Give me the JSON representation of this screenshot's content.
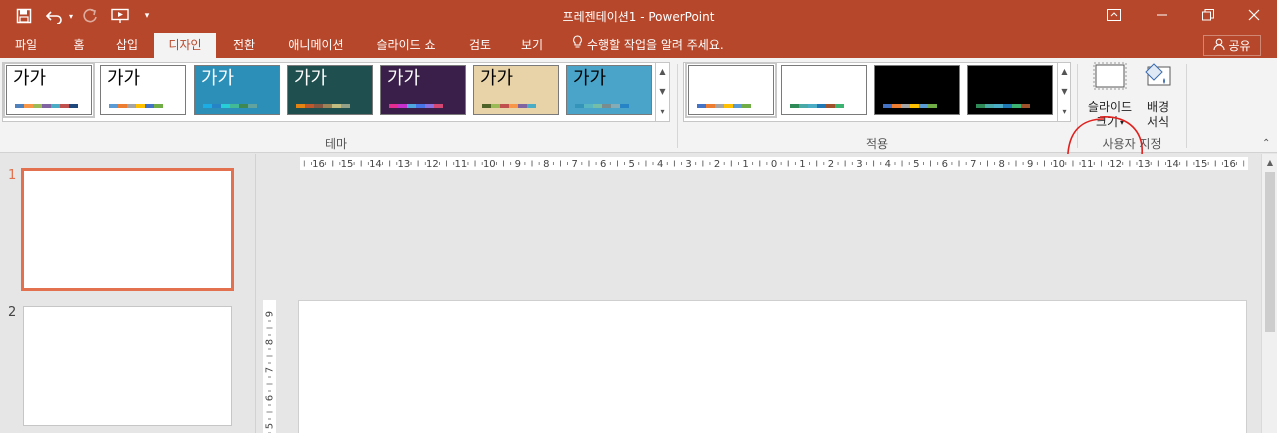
{
  "window": {
    "title": "프레젠테이션1 - PowerPoint",
    "accent": "#b7472a",
    "quick_access_icons": [
      "save-icon",
      "undo-icon",
      "undo-dropdown-icon",
      "redo-icon",
      "start-from-beginning-icon",
      "customize-quick-access-icon"
    ],
    "window_controls": [
      "ribbon-display-options-icon",
      "minimize-icon",
      "restore-icon",
      "close-icon"
    ]
  },
  "tabs": [
    {
      "label": "파일",
      "active": false
    },
    {
      "label": "홈",
      "active": false
    },
    {
      "label": "삽입",
      "active": false
    },
    {
      "label": "디자인",
      "active": true
    },
    {
      "label": "전환",
      "active": false
    },
    {
      "label": "애니메이션",
      "active": false
    },
    {
      "label": "슬라이드 쇼",
      "active": false
    },
    {
      "label": "검토",
      "active": false
    },
    {
      "label": "보기",
      "active": false
    }
  ],
  "tell_me": "수행할 작업을 알려 주세요.",
  "share": "공유",
  "ribbon": {
    "themes": {
      "label": "테마",
      "items": [
        {
          "text": "가가",
          "bg": "#ffffff",
          "fg": "#000000",
          "swatches": [
            "#4f81bd",
            "#f79646",
            "#9bbb59",
            "#8064a2",
            "#4bacc6",
            "#c0504d",
            "#1f497d"
          ]
        },
        {
          "text": "가가",
          "bg": "#ffffff",
          "fg": "#000000",
          "swatches": [
            "#5b9bd5",
            "#ed7d31",
            "#a5a5a5",
            "#ffc000",
            "#4472c4",
            "#70ad47"
          ]
        },
        {
          "text": "가가",
          "bg": "#2c8fb8",
          "fg": "#ffffff",
          "swatches": [
            "#1cade4",
            "#2683c6",
            "#27ced7",
            "#42ba97",
            "#3e8853",
            "#62a39f"
          ]
        },
        {
          "text": "가가",
          "bg": "#1f4f4f",
          "fg": "#ffffff",
          "swatches": [
            "#e48312",
            "#bd582c",
            "#865640",
            "#9b8357",
            "#c2bc80",
            "#94a088"
          ]
        },
        {
          "text": "가가",
          "bg": "#3a1f4a",
          "fg": "#ffffff",
          "swatches": [
            "#e32d91",
            "#c830cc",
            "#4ea6dc",
            "#4775e7",
            "#8971e1",
            "#d54773"
          ]
        },
        {
          "text": "가가",
          "bg": "#e8d3a8",
          "fg": "#000000",
          "swatches": [
            "#4f6228",
            "#9bbb59",
            "#c0504d",
            "#f79646",
            "#8064a2",
            "#4bacc6"
          ]
        },
        {
          "text": "가가",
          "bg": "#4aa3c8",
          "fg": "#000000",
          "swatches": [
            "#3494ba",
            "#58b6c0",
            "#75bda7",
            "#7a8c8e",
            "#84acb6",
            "#2683c6"
          ]
        }
      ]
    },
    "variants": {
      "label": "적용",
      "items": [
        {
          "bg": "#ffffff",
          "swatches": [
            "#4472c4",
            "#ed7d31",
            "#a5a5a5",
            "#ffc000",
            "#5b9bd5",
            "#70ad47"
          ]
        },
        {
          "bg": "#ffffff",
          "swatches": [
            "#2e8b57",
            "#48a9a6",
            "#4bacc6",
            "#1f77b4",
            "#a0522d",
            "#3cb371"
          ]
        },
        {
          "bg": "#000000",
          "swatches": [
            "#4472c4",
            "#ed7d31",
            "#a5a5a5",
            "#ffc000",
            "#5b9bd5",
            "#70ad47"
          ]
        },
        {
          "bg": "#000000",
          "swatches": [
            "#2e8b57",
            "#48a9a6",
            "#4bacc6",
            "#1f77b4",
            "#3cb371",
            "#a0522d"
          ]
        }
      ]
    },
    "customize": {
      "label": "사용자 지정",
      "slide_size_line1": "슬라이드",
      "slide_size_line2": "크기",
      "format_bg_line1": "배경",
      "format_bg_line2": "서식"
    }
  },
  "slides": [
    {
      "number": "1",
      "active": true
    },
    {
      "number": "2",
      "active": false
    }
  ],
  "ruler_ticks": [
    "16",
    "15",
    "14",
    "13",
    "12",
    "11",
    "10",
    "9",
    "8",
    "7",
    "6",
    "5",
    "4",
    "3",
    "2",
    "1",
    "0",
    "1",
    "2",
    "3",
    "4",
    "5",
    "6",
    "7",
    "8",
    "9",
    "10",
    "11",
    "12",
    "13",
    "14",
    "15",
    "16"
  ],
  "vruler_ticks": [
    "9",
    "8",
    "7",
    "6",
    "5"
  ]
}
